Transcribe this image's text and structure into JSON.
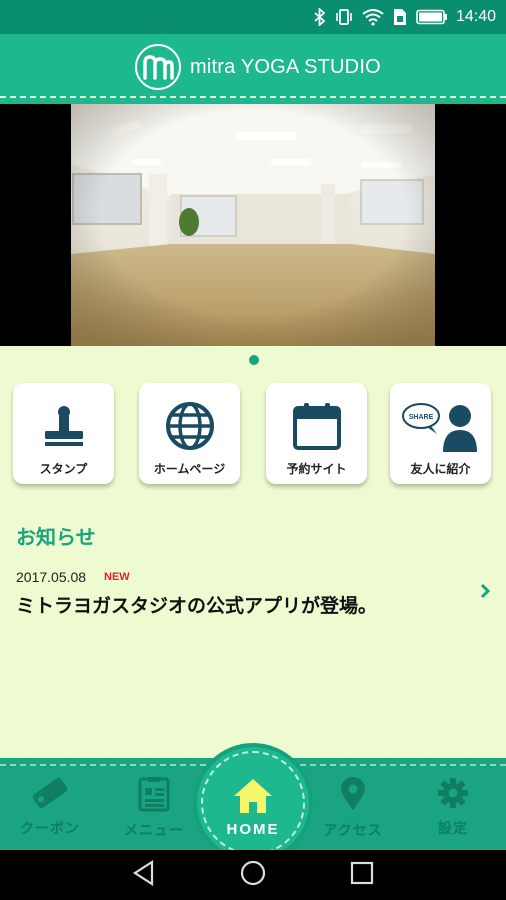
{
  "status_bar": {
    "time": "14:40",
    "icons": [
      "bluetooth-icon",
      "vibrate-icon",
      "wifi-icon",
      "sim-icon",
      "battery-icon"
    ]
  },
  "header": {
    "logo_icon": "m-logo-icon",
    "title": "mitra YOGA STUDIO",
    "color": "#1eb88f"
  },
  "hero": {
    "image": "studio-photo",
    "page_indicator": {
      "current": 1,
      "total": 1
    }
  },
  "quick_links": [
    {
      "label": "スタンプ",
      "icon": "stamp-icon"
    },
    {
      "label": "ホームページ",
      "icon": "globe-icon"
    },
    {
      "label": "予約サイト",
      "icon": "calendar-icon"
    },
    {
      "label": "友人に紹介",
      "icon": "share-friend-icon",
      "icon_text": "SHARE"
    }
  ],
  "news": {
    "title": "お知らせ",
    "items": [
      {
        "date": "2017.05.08",
        "badge": "NEW",
        "text": "ミトラヨガスタジオの公式アプリが登場。"
      }
    ]
  },
  "tabs": [
    {
      "label": "クーポン",
      "icon": "coupon-icon"
    },
    {
      "label": "メニュー",
      "icon": "menu-icon"
    },
    {
      "label": "HOME",
      "icon": "home-icon",
      "active": true
    },
    {
      "label": "アクセス",
      "icon": "map-pin-icon"
    },
    {
      "label": "設定",
      "icon": "gear-icon"
    }
  ],
  "colors": {
    "accent": "#1eb88f",
    "dark_accent": "#0f7e63",
    "background": "#eefad0",
    "badge": "#e8202a"
  }
}
